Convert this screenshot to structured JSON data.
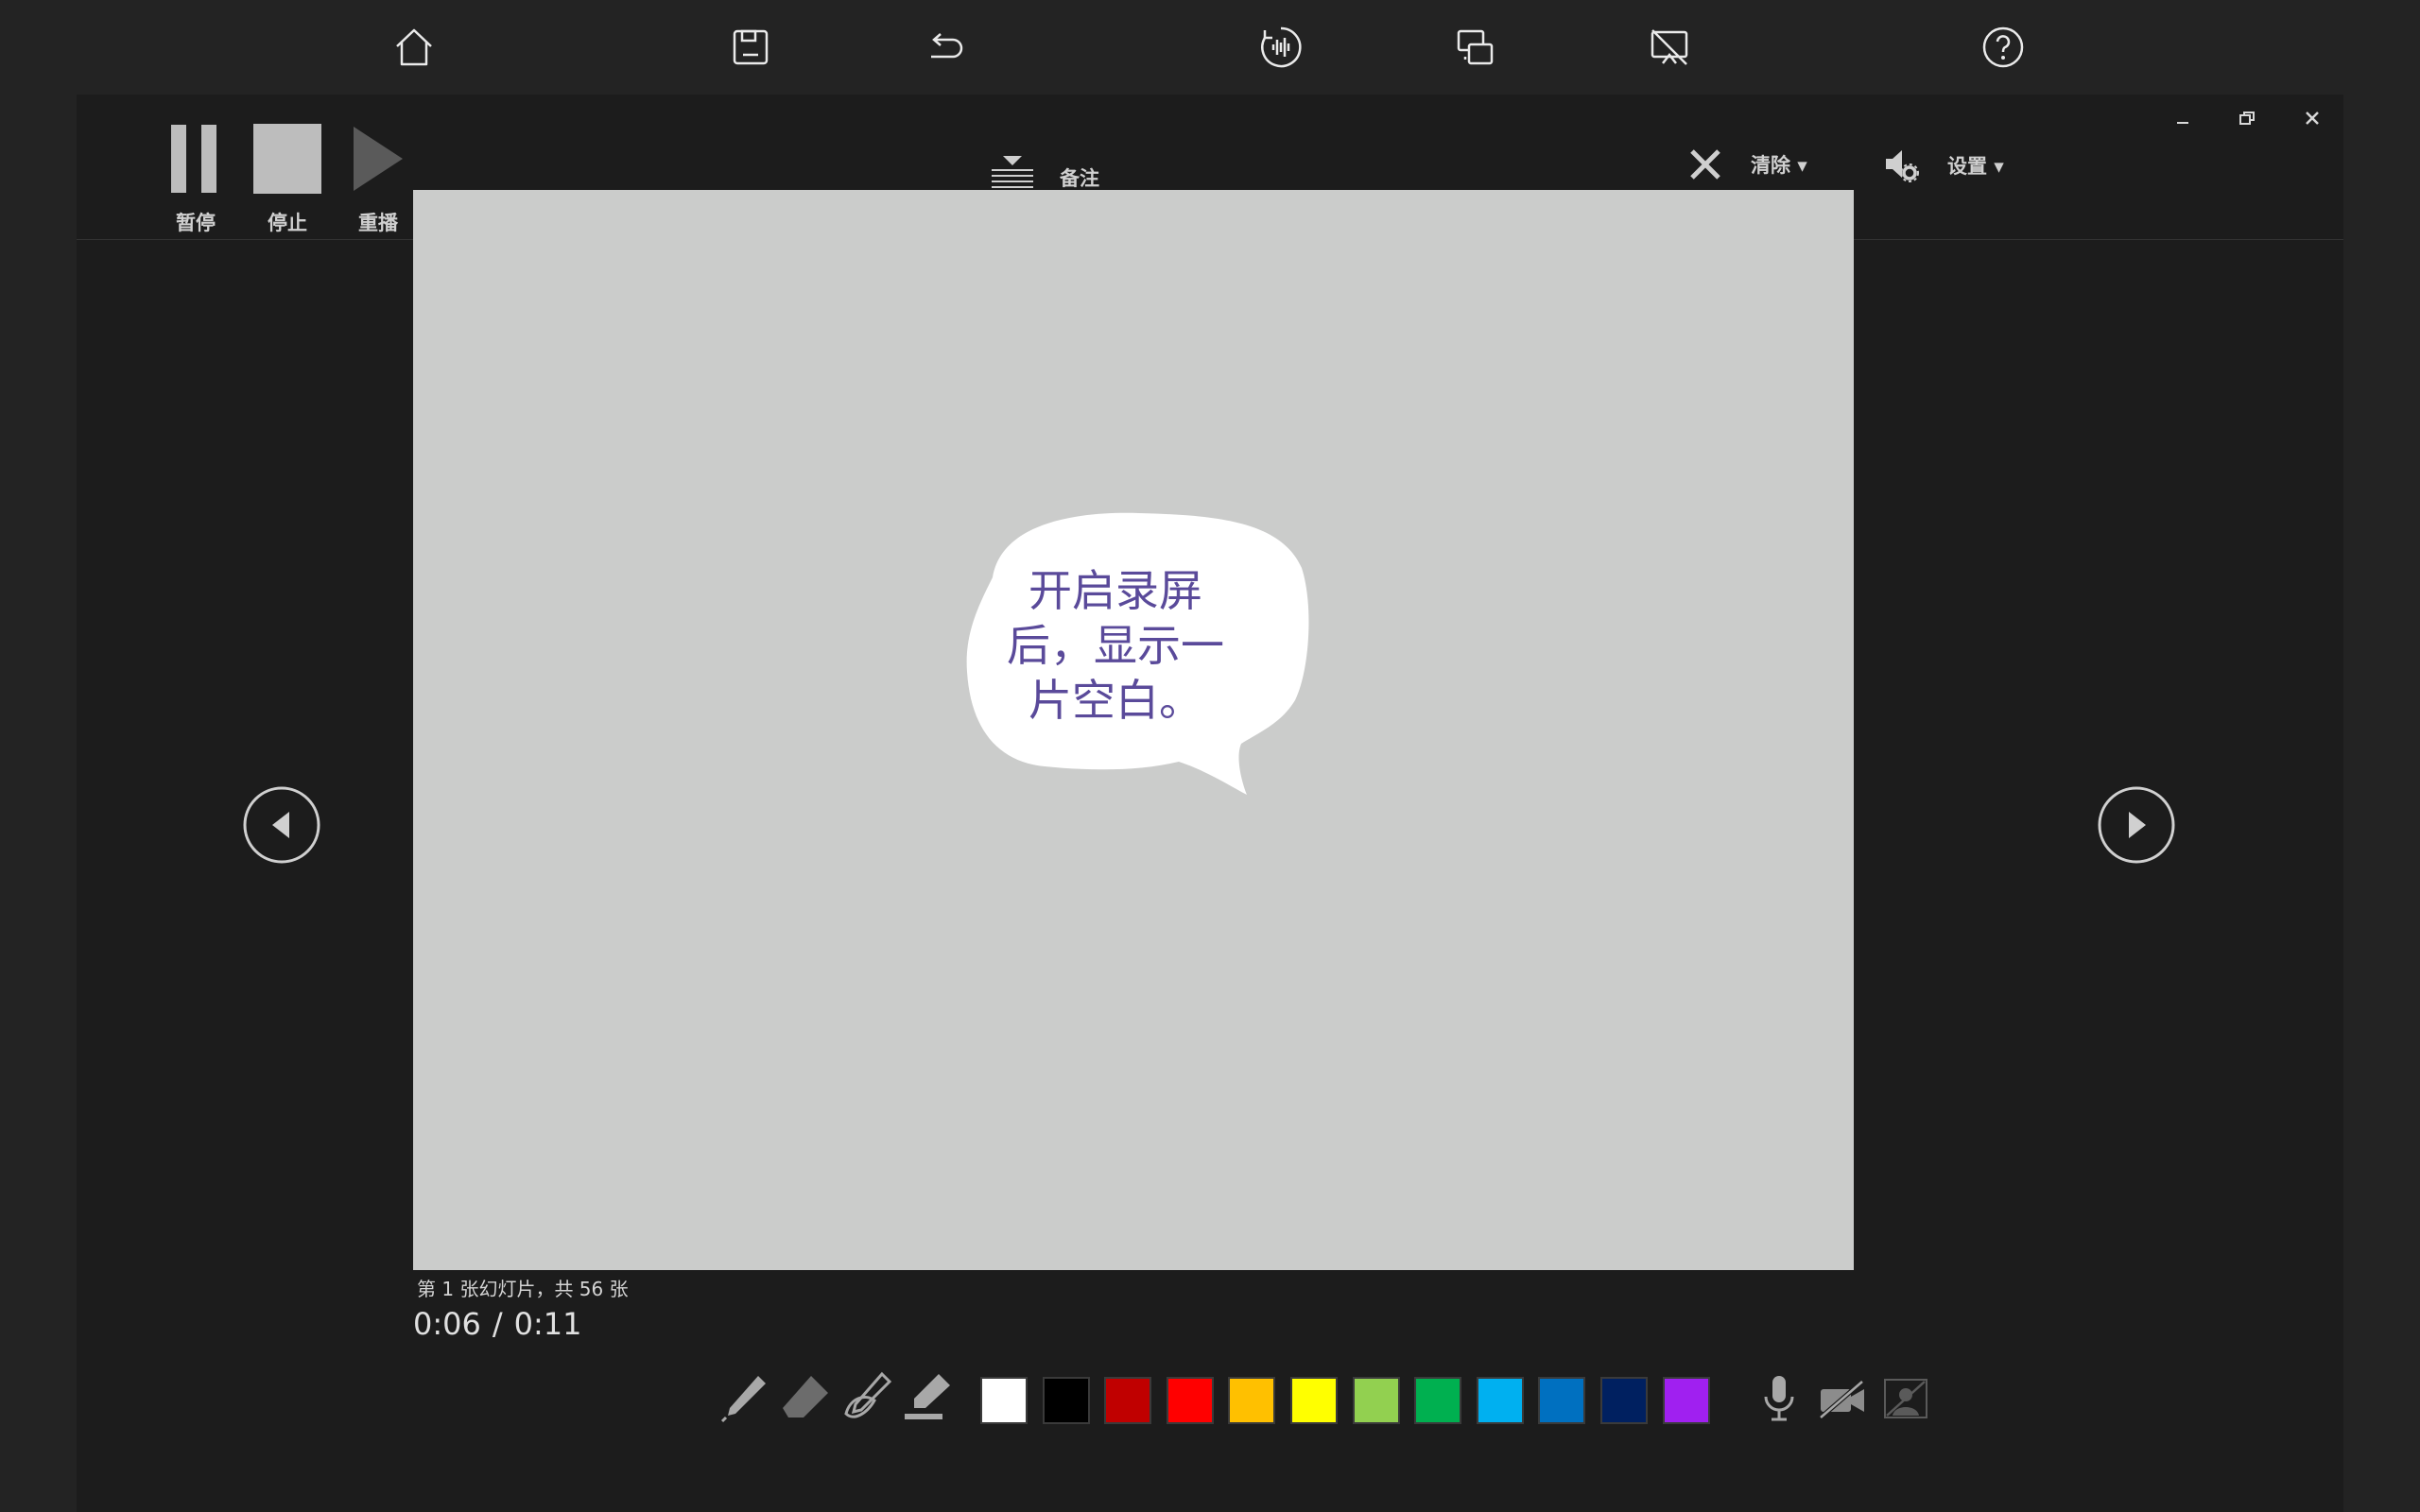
{
  "top_toolbar": {
    "icons": [
      "home-icon",
      "save-icon",
      "undo-icon",
      "audio-icon",
      "screen-record-icon",
      "presentation-off-icon",
      "help-icon"
    ]
  },
  "recording": {
    "pause_label": "暂停",
    "stop_label": "停止",
    "replay_label": "重播",
    "notes_label": "备注",
    "clear_label": "清除 ▾",
    "settings_label": "设置 ▾"
  },
  "slide": {
    "bubble_text_line1": "开启录屏",
    "bubble_text_line2": "后，显示一",
    "bubble_text_line3": "片空白。",
    "background": "#cbcccb",
    "text_color": "#5a4a9a"
  },
  "status": {
    "slide_counter": "第 1 张幻灯片，共 56 张",
    "elapsed": "0:06",
    "separator": "/",
    "total": "0:11"
  },
  "pen_tools": [
    "pen-icon",
    "eraser-icon",
    "laser-pen-icon",
    "highlighter-icon"
  ],
  "colors": [
    "#ffffff",
    "#000000",
    "#c00000",
    "#ff0000",
    "#ffc000",
    "#ffff00",
    "#92d050",
    "#00b050",
    "#00b0f0",
    "#0070c0",
    "#002060",
    "#a020f0"
  ],
  "media_controls": [
    "microphone-icon",
    "camera-off-icon",
    "camera-preview-off-icon"
  ]
}
